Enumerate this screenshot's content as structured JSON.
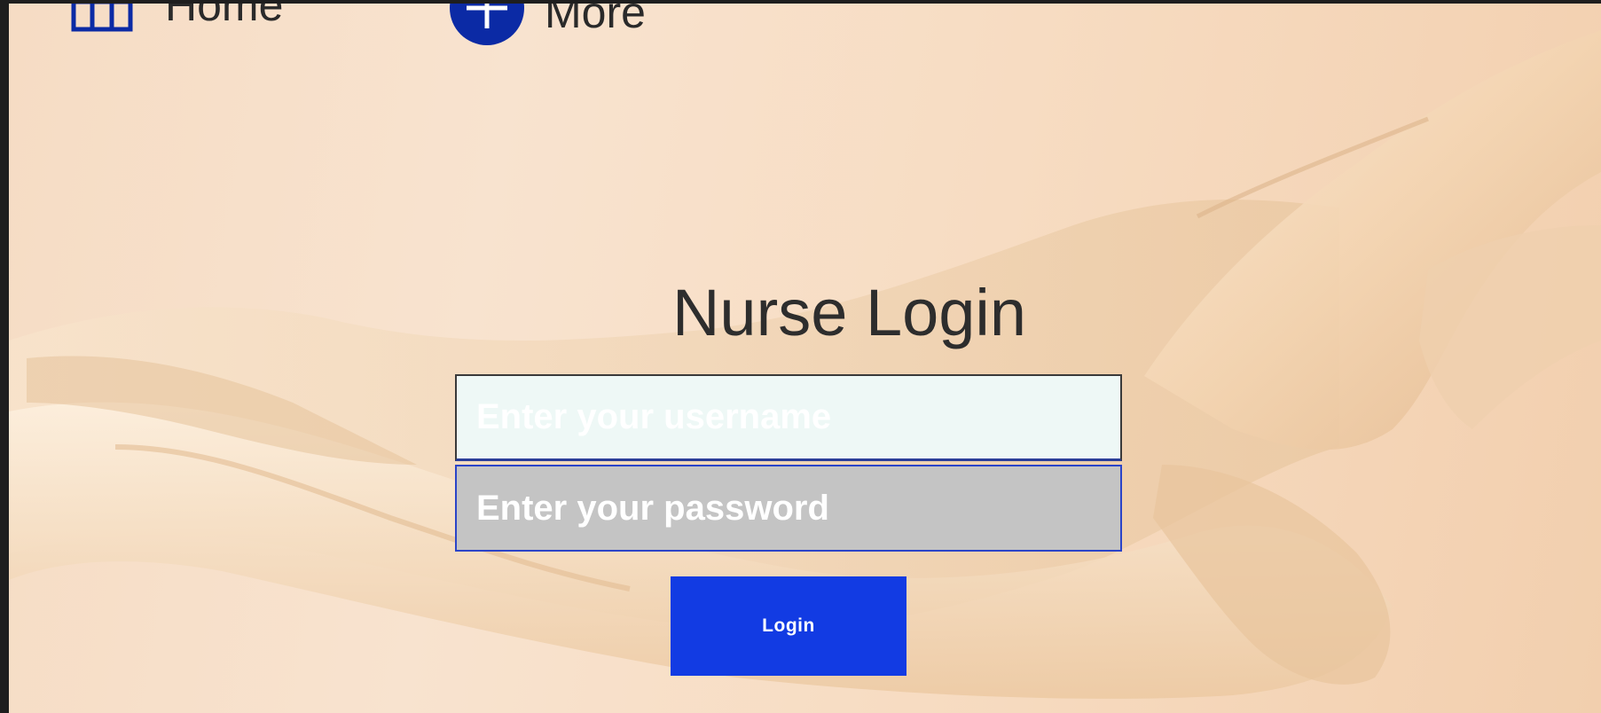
{
  "nav": {
    "home_label": "Home",
    "more_label": "More"
  },
  "login": {
    "title": "Nurse Login",
    "username_placeholder": "Enter your username",
    "password_placeholder": "Enter your password",
    "button_label": "Login"
  },
  "colors": {
    "accent": "#123be3",
    "nav_icon": "#0b2aa5",
    "title_text": "#2d2d2d",
    "username_bg": "#eef8f6",
    "password_bg": "#c4c4c4"
  },
  "icons": {
    "home": "grid-icon",
    "more": "plus-circle-icon"
  }
}
